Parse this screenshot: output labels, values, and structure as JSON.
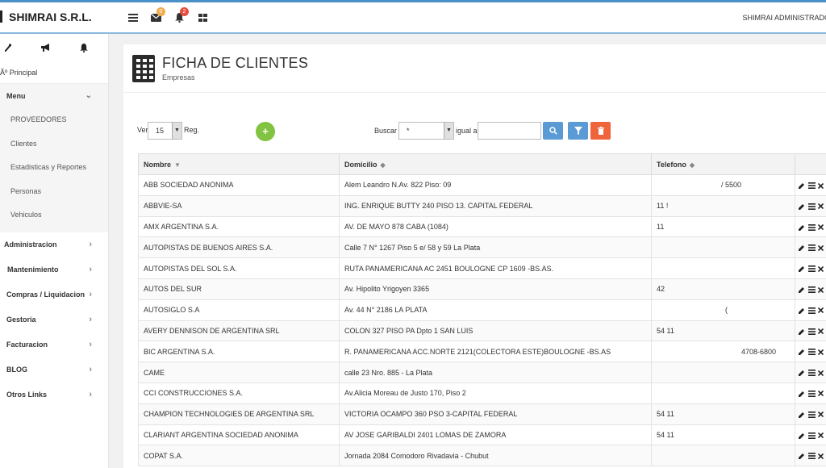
{
  "brand": {
    "name": "SHIMRAI S.R.L."
  },
  "topbar": {
    "mail_badge": "0",
    "bell_badge": "2",
    "user": "SHIMRAI ADMINISTRADO"
  },
  "sidebar": {
    "principal": "Ãº Principal",
    "menu_label": "Menu",
    "menu_items": [
      {
        "label": "PROVEEDORES"
      },
      {
        "label": "Clientes"
      },
      {
        "label": "Estadisticas y Reportes"
      },
      {
        "label": "Personas"
      },
      {
        "label": "Vehiculos"
      }
    ],
    "nav": [
      {
        "label": "Administracion"
      },
      {
        "label": "Mantenimiento"
      },
      {
        "label": "Compras / Liquidacion"
      },
      {
        "label": "Gestoria"
      },
      {
        "label": "Facturacion"
      },
      {
        "label": "BLOG"
      },
      {
        "label": "Otros Links"
      }
    ]
  },
  "page": {
    "title": "FICHA DE CLIENTES",
    "subtitle": "Empresas"
  },
  "controls": {
    "ver_label": "Ver",
    "page_size": "15",
    "reg_label": "Reg.",
    "buscar_label": "Buscar",
    "search_field": "*",
    "igual_label": "igual a",
    "search_value": ""
  },
  "table": {
    "headers": {
      "nombre": "Nombre",
      "domicilio": "Domicilio",
      "telefono": "Telefono"
    },
    "rows": [
      {
        "nombre": "ABB SOCIEDAD ANONIMA",
        "domicilio": "Alem Leandro N.Av. 822 Piso: 09",
        "telefono": "                                / 5500"
      },
      {
        "nombre": "ABBVIE-SA",
        "domicilio": "ING. ENRIQUE BUTTY 240 PISO 13. CAPITAL FEDERAL",
        "telefono": "11 !"
      },
      {
        "nombre": "AMX ARGENTINA S.A.",
        "domicilio": "AV. DE MAYO 878 CABA (1084)",
        "telefono": "11"
      },
      {
        "nombre": "AUTOPISTAS DE BUENOS AIRES S.A.",
        "domicilio": "Calle 7 N° 1267 Piso 5 e/ 58 y 59 La Plata",
        "telefono": ""
      },
      {
        "nombre": "AUTOPISTAS DEL SOL S.A.",
        "domicilio": "RUTA PANAMERICANA AC 2451 BOULOGNE CP 1609 -BS.AS.",
        "telefono": ""
      },
      {
        "nombre": "AUTOS DEL SUR",
        "domicilio": "Av. Hipolito Yrigoyen 3365",
        "telefono": "42"
      },
      {
        "nombre": "AUTOSIGLO S.A",
        "domicilio": "Av. 44 N° 2186 LA PLATA",
        "telefono": "                                  ("
      },
      {
        "nombre": "AVERY DENNISON DE ARGENTINA SRL",
        "domicilio": "COLON 327 PISO PA Dpto 1 SAN LUIS",
        "telefono": "54 11"
      },
      {
        "nombre": "BIC ARGENTINA S.A.",
        "domicilio": "R. PANAMERICANA ACC.NORTE 2121(COLECTORA ESTE)BOULOGNE -BS.AS",
        "telefono": "                                          4708-6800"
      },
      {
        "nombre": "CAME",
        "domicilio": "calle 23 Nro. 885 - La Plata",
        "telefono": ""
      },
      {
        "nombre": "CCI CONSTRUCCIONES S.A.",
        "domicilio": "Av.Alicia Moreau de Justo 170, Piso 2",
        "telefono": ""
      },
      {
        "nombre": "CHAMPION TECHNOLOGIES DE ARGENTINA SRL",
        "domicilio": "VICTORIA OCAMPO 360 PSO 3-CAPITAL FEDERAL",
        "telefono": "54 11"
      },
      {
        "nombre": "CLARIANT ARGENTINA SOCIEDAD ANONIMA",
        "domicilio": "AV JOSE GARIBALDI 2401 LOMAS DE ZAMORA",
        "telefono": "54 11"
      },
      {
        "nombre": "COPAT S.A.",
        "domicilio": "Jornada 2084 Comodoro Rivadavia - Chubut",
        "telefono": ""
      }
    ]
  },
  "colors": {
    "accent": "#4a90c9",
    "add": "#82c341",
    "search_btn": "#5b9bd5",
    "delete_btn": "#f0643c"
  },
  "icons": [
    "menu-icon",
    "mail-icon",
    "bell-icon",
    "grid-icon",
    "edit-icon",
    "list-icon",
    "delete-icon",
    "building-icon"
  ]
}
